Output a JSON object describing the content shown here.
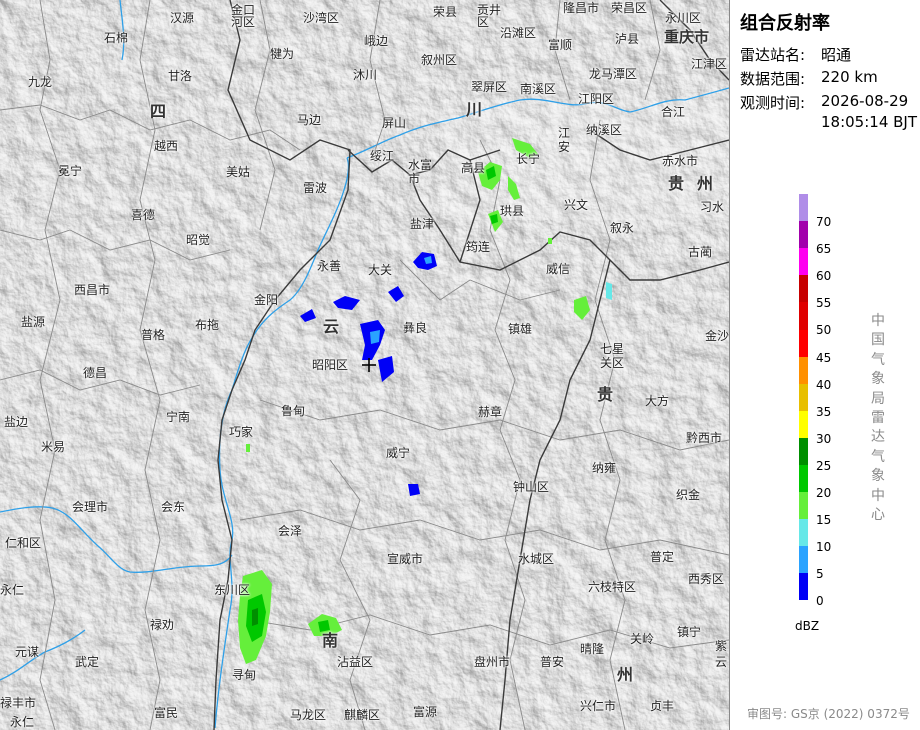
{
  "panel": {
    "title": "组合反射率",
    "station_label": "雷达站名:",
    "station_value": "昭通",
    "range_label": "数据范围:",
    "range_value": "220 km",
    "time_label": "观测时间:",
    "time_date": "2026-08-29",
    "time_clock": "18:05:14 BJT",
    "credit": "中国气象局雷达气象中心",
    "unit": "dBZ",
    "footer": "审图号: GS京 (2022) 0372号"
  },
  "legend": [
    {
      "value": "70",
      "color": "#b08de8"
    },
    {
      "value": "65",
      "color": "#a200ac"
    },
    {
      "value": "60",
      "color": "#ff00f0"
    },
    {
      "value": "55",
      "color": "#c70000"
    },
    {
      "value": "50",
      "color": "#e00000"
    },
    {
      "value": "45",
      "color": "#ff0000"
    },
    {
      "value": "40",
      "color": "#ff9000"
    },
    {
      "value": "35",
      "color": "#e8bf00"
    },
    {
      "value": "30",
      "color": "#ffff00"
    },
    {
      "value": "25",
      "color": "#008f00"
    },
    {
      "value": "20",
      "color": "#00c800"
    },
    {
      "value": "15",
      "color": "#65ef3b"
    },
    {
      "value": "10",
      "color": "#66e8e8"
    },
    {
      "value": "5",
      "color": "#2aa3ff"
    },
    {
      "value": "0",
      "color": "#0000f6"
    }
  ],
  "places": [
    {
      "id": "hanyuan",
      "name": "汉源"
    },
    {
      "id": "jinkou",
      "name": "金口\n河区"
    },
    {
      "id": "shawan",
      "name": "沙湾区"
    },
    {
      "id": "rongxian",
      "name": "荣县"
    },
    {
      "id": "gongjing",
      "name": "贡井\n区"
    },
    {
      "id": "longchang",
      "name": "隆昌市"
    },
    {
      "id": "rongchang",
      "name": "荣昌区"
    },
    {
      "id": "yongchuan",
      "name": "永川区"
    },
    {
      "id": "shimian",
      "name": "石棉"
    },
    {
      "id": "ebian",
      "name": "峨边"
    },
    {
      "id": "qianwei",
      "name": "犍为"
    },
    {
      "id": "xuzhou",
      "name": "叙州区"
    },
    {
      "id": "yanjiang",
      "name": "沿滩区"
    },
    {
      "id": "fushun",
      "name": "富顺"
    },
    {
      "id": "luxian",
      "name": "泸县"
    },
    {
      "id": "chongqing",
      "name": "重庆市"
    },
    {
      "id": "jiujin",
      "name": "江津区"
    },
    {
      "id": "jiulong",
      "name": "九龙"
    },
    {
      "id": "ganluo",
      "name": "甘洛"
    },
    {
      "id": "muchuan",
      "name": "沐川"
    },
    {
      "id": "cuiping",
      "name": "翠屏区"
    },
    {
      "id": "nanxi",
      "name": "南溪区"
    },
    {
      "id": "longmatan",
      "name": "龙马潭区"
    },
    {
      "id": "jiangyang",
      "name": "江阳区"
    },
    {
      "id": "sichuan",
      "name": "四"
    },
    {
      "id": "chuan",
      "name": "川"
    },
    {
      "id": "mabian",
      "name": "马边"
    },
    {
      "id": "pingshan",
      "name": "屏山"
    },
    {
      "id": "changan",
      "name": "江\n安"
    },
    {
      "id": "naxi",
      "name": "纳溪区"
    },
    {
      "id": "hejiang",
      "name": "合江"
    },
    {
      "id": "yuexi",
      "name": "越西"
    },
    {
      "id": "changning",
      "name": "长宁"
    },
    {
      "id": "mianning",
      "name": "冕宁"
    },
    {
      "id": "meigu",
      "name": "美姑"
    },
    {
      "id": "suijiang",
      "name": "绥江"
    },
    {
      "id": "shuifu",
      "name": "水富\n市"
    },
    {
      "id": "gaoxian",
      "name": "高县"
    },
    {
      "id": "chishui",
      "name": "赤水市"
    },
    {
      "id": "gui",
      "name": "贵"
    },
    {
      "id": "zhou",
      "name": "州"
    },
    {
      "id": "leibo",
      "name": "雷波"
    },
    {
      "id": "xichang_xide",
      "name": "喜德"
    },
    {
      "id": "gongxian",
      "name": "珙县"
    },
    {
      "id": "xingwen",
      "name": "兴文"
    },
    {
      "id": "xishui",
      "name": "习水"
    },
    {
      "id": "zhaojue",
      "name": "昭觉"
    },
    {
      "id": "yanjin",
      "name": "盐津"
    },
    {
      "id": "xuyong",
      "name": "叙永"
    },
    {
      "id": "junlian",
      "name": "筠连"
    },
    {
      "id": "gulin",
      "name": "古蔺"
    },
    {
      "id": "yongshan",
      "name": "永善"
    },
    {
      "id": "daguan",
      "name": "大关"
    },
    {
      "id": "weixin",
      "name": "威信"
    },
    {
      "id": "xichang",
      "name": "西昌市"
    },
    {
      "id": "jinyang",
      "name": "金阳"
    },
    {
      "id": "yanyuan",
      "name": "盐源"
    },
    {
      "id": "butuo",
      "name": "布拖"
    },
    {
      "id": "yun",
      "name": "云"
    },
    {
      "id": "yiliang",
      "name": "彝良"
    },
    {
      "id": "zhenxiong",
      "name": "镇雄"
    },
    {
      "id": "puge",
      "name": "普格"
    },
    {
      "id": "jinsha",
      "name": "金沙"
    },
    {
      "id": "qixingguan",
      "name": "七星\n关区"
    },
    {
      "id": "zhaoyang",
      "name": "昭阳区"
    },
    {
      "id": "dechang",
      "name": "德昌"
    },
    {
      "id": "gui2",
      "name": "贵"
    },
    {
      "id": "dafang",
      "name": "大方"
    },
    {
      "id": "ningnan",
      "name": "宁南"
    },
    {
      "id": "ludian",
      "name": "鲁甸"
    },
    {
      "id": "hezhang",
      "name": "赫章"
    },
    {
      "id": "yanbian",
      "name": "盐边"
    },
    {
      "id": "qiaojia",
      "name": "巧家"
    },
    {
      "id": "qianxi",
      "name": "黔西市"
    },
    {
      "id": "miyi",
      "name": "米易"
    },
    {
      "id": "weining",
      "name": "威宁"
    },
    {
      "id": "nayong",
      "name": "纳雍"
    },
    {
      "id": "zhijin",
      "name": "织金"
    },
    {
      "id": "huili",
      "name": "会理市"
    },
    {
      "id": "huidong",
      "name": "会东"
    },
    {
      "id": "zhongshan",
      "name": "钟山区"
    },
    {
      "id": "renhe",
      "name": "仁和区"
    },
    {
      "id": "huize",
      "name": "会泽"
    },
    {
      "id": "shuicheng",
      "name": "水城区"
    },
    {
      "id": "puding",
      "name": "普定"
    },
    {
      "id": "xiuwen",
      "name": "西秀区"
    },
    {
      "id": "xuanwei",
      "name": "宣威市"
    },
    {
      "id": "yongren",
      "name": "永仁"
    },
    {
      "id": "dongchuan",
      "name": "东川区"
    },
    {
      "id": "liuzhi",
      "name": "六枝特区"
    },
    {
      "id": "luquan",
      "name": "禄劝"
    },
    {
      "id": "guanling",
      "name": "关岭"
    },
    {
      "id": "zhenning",
      "name": "镇宁"
    },
    {
      "id": "yuanmou",
      "name": "元谋"
    },
    {
      "id": "wuding",
      "name": "武定"
    },
    {
      "id": "nan",
      "name": "南"
    },
    {
      "id": "zhanyi",
      "name": "沾益区"
    },
    {
      "id": "panzhou",
      "name": "盘州市"
    },
    {
      "id": "puan",
      "name": "普安"
    },
    {
      "id": "qinglong",
      "name": "晴隆"
    },
    {
      "id": "zhou2",
      "name": "州"
    },
    {
      "id": "zi",
      "name": "紫"
    },
    {
      "id": "xundian",
      "name": "寻甸"
    },
    {
      "id": "ziyun",
      "name": "云"
    },
    {
      "id": "fumin",
      "name": "富民"
    },
    {
      "id": "malong",
      "name": "马龙区"
    },
    {
      "id": "qilin",
      "name": "麒麟区"
    },
    {
      "id": "fuyuan",
      "name": "富源"
    },
    {
      "id": "xingren",
      "name": "兴仁市"
    },
    {
      "id": "zhenfeng",
      "name": "贞丰"
    },
    {
      "id": "lufeng",
      "name": "禄丰市"
    },
    {
      "id": "yongren2",
      "name": "永仁"
    },
    {
      "id": "jiangwei",
      "name": "禄丰市"
    }
  ]
}
